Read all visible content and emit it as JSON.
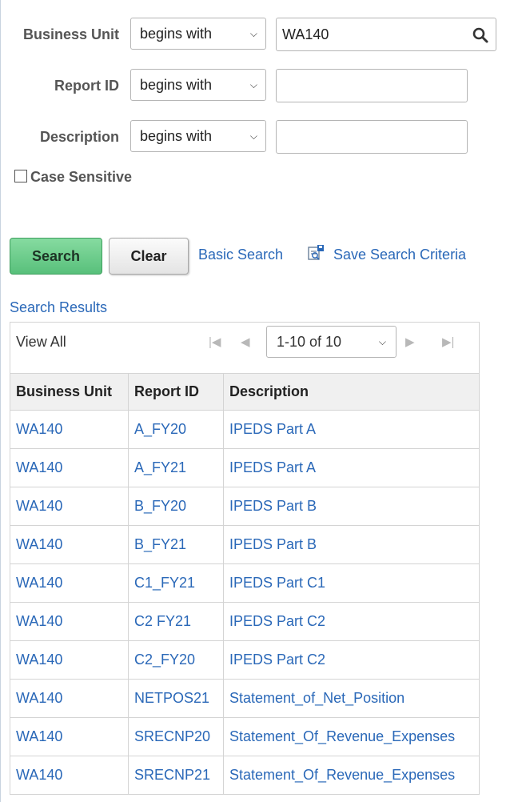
{
  "criteria": [
    {
      "label": "Business Unit",
      "operator": "begins with",
      "value": "WA140",
      "has_lookup": true
    },
    {
      "label": "Report ID",
      "operator": "begins with",
      "value": ""
    },
    {
      "label": "Description",
      "operator": "begins with",
      "value": ""
    }
  ],
  "case_sensitive": {
    "label": "Case Sensitive",
    "checked": false
  },
  "buttons": {
    "search": "Search",
    "clear": "Clear"
  },
  "links": {
    "basic_search": "Basic Search",
    "save_search_criteria": "Save Search Criteria"
  },
  "results": {
    "title": "Search Results",
    "view_all": "View All",
    "page_range": "1-10 of 10",
    "columns": [
      "Business Unit",
      "Report ID",
      "Description"
    ],
    "rows": [
      [
        "WA140",
        "A_FY20",
        "IPEDS Part A"
      ],
      [
        "WA140",
        "A_FY21",
        "IPEDS Part A"
      ],
      [
        "WA140",
        "B_FY20",
        "IPEDS Part B"
      ],
      [
        "WA140",
        "B_FY21",
        "IPEDS Part B"
      ],
      [
        "WA140",
        "C1_FY21",
        "IPEDS Part C1"
      ],
      [
        "WA140",
        "C2 FY21",
        "IPEDS Part C2"
      ],
      [
        "WA140",
        "C2_FY20",
        "IPEDS Part C2"
      ],
      [
        "WA140",
        "NETPOS21",
        "Statement_of_Net_Position"
      ],
      [
        "WA140",
        "SRECNP20",
        "Statement_Of_Revenue_Expenses"
      ],
      [
        "WA140",
        "SRECNP21",
        "Statement_Of_Revenue_Expenses"
      ]
    ]
  },
  "icons": {
    "lookup": "magnifier-icon",
    "save": "save-criteria-icon",
    "first": "first-page-icon",
    "prev": "previous-page-icon",
    "next": "next-page-icon",
    "last": "last-page-icon"
  },
  "colors": {
    "link": "#2a68b8",
    "search_button": "#58c07b"
  }
}
